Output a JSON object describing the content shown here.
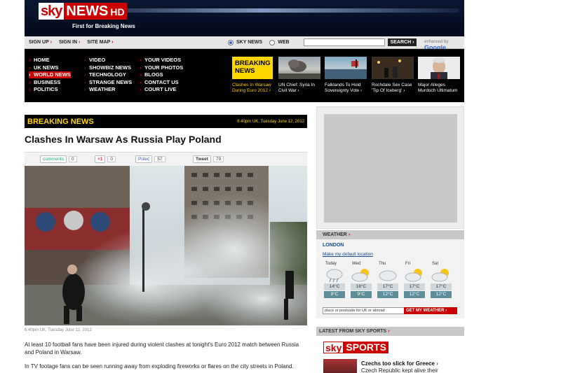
{
  "header": {
    "logo_sky": "sky",
    "logo_news": "NEWS",
    "logo_hd": "HD",
    "tagline": "First for Breaking News"
  },
  "topbar": {
    "signup": "SIGN UP",
    "signin": "SIGN IN",
    "sitemap": "SITE MAP",
    "opt_skynews": "SKY NEWS",
    "opt_web": "WEB",
    "search_btn": "SEARCH ›",
    "enhanced": "enhanced by",
    "google": "Google"
  },
  "nav": {
    "col1": [
      "HOME",
      "UK NEWS",
      "WORLD NEWS",
      "BUSINESS",
      "POLITICS"
    ],
    "col2": [
      "VIDEO",
      "SHOWBIZ NEWS",
      "TECHNOLOGY",
      "STRANGE NEWS",
      "WEATHER"
    ],
    "col3": [
      "YOUR VIDEOS",
      "YOUR PHOTOS",
      "BLOGS",
      "CONTACT US",
      "COURT LIVE"
    ],
    "active": "WORLD NEWS",
    "breaking_box": "BREAKING NEWS",
    "promos": [
      "Clashes In Warsaw During Euro 2012 ›",
      "UN Chief: Syria In Civil War ›",
      "Falklands To Hold Sovereignty Vote ›",
      "Rochdale Sex Case 'Tip Of Iceberg' ›",
      "Major Alleges Murdoch Ultimatum"
    ]
  },
  "article": {
    "breaking_label": "BREAKING NEWS",
    "timestamp": "6:40pm UK, Tuesday June 12, 2012",
    "headline": "Clashes In Warsaw As Russia Play Poland",
    "share": {
      "comments_label": "comments",
      "comments_count": "0",
      "gplus_label": "+1",
      "gplus_count": "0",
      "fb_label": "Poleć",
      "fb_count": "57",
      "tweet_label": "Tweet",
      "tweet_count": "79"
    },
    "caption": "6:40pm UK, Tuesday June 12, 2012",
    "para1": "At least 10 football fans have been injured during violent clashes at tonight's Euro 2012 match between Russia and Poland in Warsaw.",
    "para2": "In TV footage fans can be seen running away from exploding fireworks or flares on the city streets in Poland."
  },
  "weather": {
    "title": "WEATHER",
    "city": "LONDON",
    "default_link": "Make my default location",
    "days": [
      {
        "name": "Today",
        "hi": "14°C",
        "lo": "9°C",
        "icon": "rain-cloud-icon"
      },
      {
        "name": "Wed",
        "hi": "16°C",
        "lo": "9°C",
        "icon": "sun-cloud-icon"
      },
      {
        "name": "Thu",
        "hi": "17°C",
        "lo": "12°C",
        "icon": "cloud-icon"
      },
      {
        "name": "Fri",
        "hi": "17°C",
        "lo": "12°C",
        "icon": "sun-cloud-icon"
      },
      {
        "name": "Sat",
        "hi": "17°C",
        "lo": "12°C",
        "icon": "sun-cloud-icon"
      }
    ],
    "postcode_placeholder": "place or postcode for UK or abroad",
    "my_weather_btn": "GET MY WEATHER"
  },
  "sports": {
    "title": "LATEST FROM SKY SPORTS",
    "logo_sky": "sky",
    "logo_sports": "SPORTS",
    "story_title": "Czechs too slick for Greece",
    "story_sub": "Czech Republic kept alive their"
  },
  "colors": {
    "brand_red": "#cc0000",
    "breaking_yellow": "#ffd700",
    "nav_black": "#000000"
  }
}
